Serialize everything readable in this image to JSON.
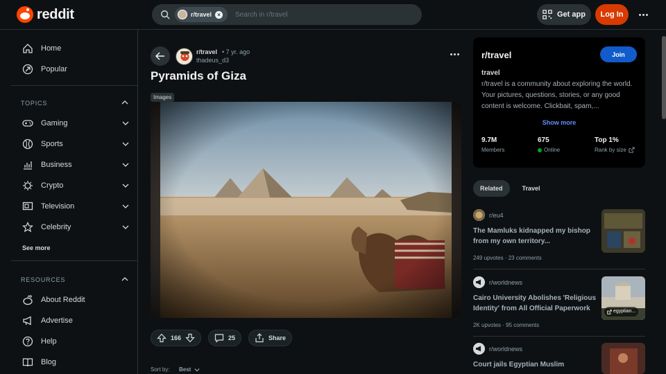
{
  "header": {
    "logo_text": "reddit",
    "search_chip": "r/travel",
    "search_placeholder": "Search in r/travel",
    "get_app": "Get app",
    "login": "Log In"
  },
  "sidebar": {
    "top_items": [
      {
        "label": "Home",
        "icon": "home-icon"
      },
      {
        "label": "Popular",
        "icon": "popular-icon"
      }
    ],
    "topics_heading": "TOPICS",
    "topics": [
      {
        "label": "Gaming",
        "icon": "gamepad-icon"
      },
      {
        "label": "Sports",
        "icon": "sports-ball-icon"
      },
      {
        "label": "Business",
        "icon": "chart-icon"
      },
      {
        "label": "Crypto",
        "icon": "crypto-icon"
      },
      {
        "label": "Television",
        "icon": "tv-icon"
      },
      {
        "label": "Celebrity",
        "icon": "star-icon"
      }
    ],
    "see_more": "See more",
    "resources_heading": "RESOURCES",
    "resources": [
      {
        "label": "About Reddit",
        "icon": "reddit-icon"
      },
      {
        "label": "Advertise",
        "icon": "megaphone-icon"
      },
      {
        "label": "Help",
        "icon": "help-icon"
      },
      {
        "label": "Blog",
        "icon": "book-icon"
      }
    ]
  },
  "post": {
    "subreddit": "r/travel",
    "time": "• 7 yr. ago",
    "author": "thadeus_d3",
    "title": "Pyramids of Giza",
    "flair": "Images",
    "upvotes": "166",
    "comments": "25",
    "share": "Share",
    "sort_label": "Sort by:",
    "sort_value": "Best"
  },
  "aside": {
    "name": "r/travel",
    "join": "Join",
    "subtitle": "travel",
    "description": "r/travel is a community about exploring the world. Your pictures, questions, stories, or any good content is welcome. Clickbait, spam,...",
    "show_more": "Show more",
    "members_value": "9.7M",
    "members_label": "Members",
    "online_value": "675",
    "online_label": "Online",
    "rank_value": "Top 1%",
    "rank_label": "Rank by size"
  },
  "related_tabs": [
    "Related",
    "Travel"
  ],
  "related": [
    {
      "sub": "r/eu4",
      "title": "The Mamluks kidnapped my bishop from my own territory...",
      "meta": "249 upvotes · 23 comments"
    },
    {
      "sub": "r/worldnews",
      "title": "Cairo University Abolishes 'Religious Identity' from All Official Paperwork",
      "meta": "2K upvotes · 95 comments",
      "thumb_label": "egyptian..."
    },
    {
      "sub": "r/worldnews",
      "title": "Court jails Egyptian Muslim",
      "meta": ""
    }
  ]
}
